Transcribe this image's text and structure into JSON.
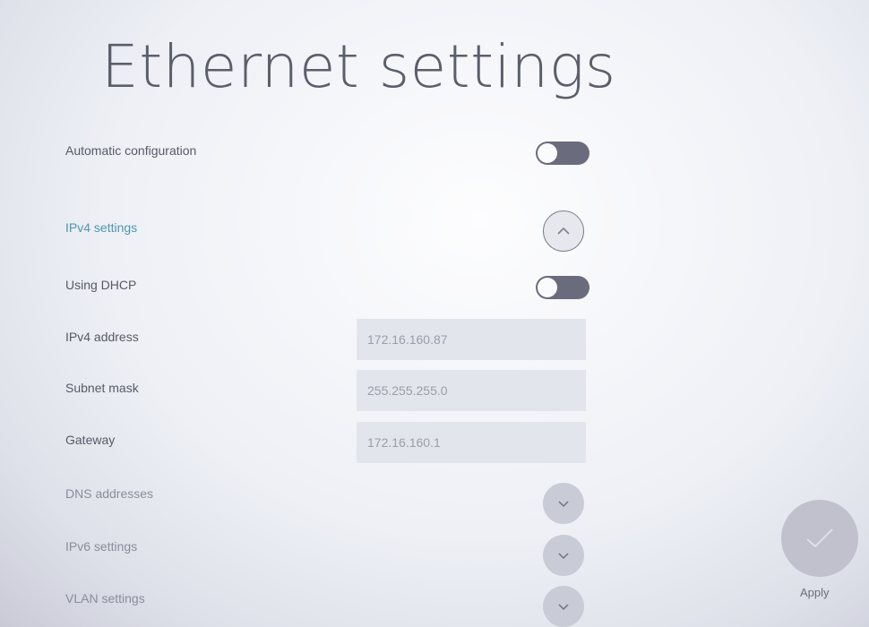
{
  "page": {
    "title": "Ethernet settings"
  },
  "settings": {
    "automatic_configuration": {
      "label": "Automatic configuration",
      "state": "off"
    },
    "ipv4_settings": {
      "label": "IPv4 settings",
      "expanded": true
    },
    "using_dhcp": {
      "label": "Using DHCP",
      "state": "off"
    },
    "ipv4_address": {
      "label": "IPv4 address",
      "value": "172.16.160.87"
    },
    "subnet_mask": {
      "label": "Subnet mask",
      "value": "255.255.255.0"
    },
    "gateway": {
      "label": "Gateway",
      "value": "172.16.160.1"
    },
    "dns_addresses": {
      "label": "DNS addresses",
      "expanded": false
    },
    "ipv6_settings": {
      "label": "IPv6 settings",
      "expanded": false
    },
    "vlan_settings": {
      "label": "VLAN settings",
      "expanded": false
    }
  },
  "apply": {
    "label": "Apply",
    "icon": "check-icon"
  },
  "icons": {
    "expanded": "chevron-up-icon",
    "collapsed": "chevron-down-icon"
  },
  "colors": {
    "accent_link": "#4e97ad",
    "toggle_off": "#6a6b7c",
    "text": "#565a66"
  }
}
